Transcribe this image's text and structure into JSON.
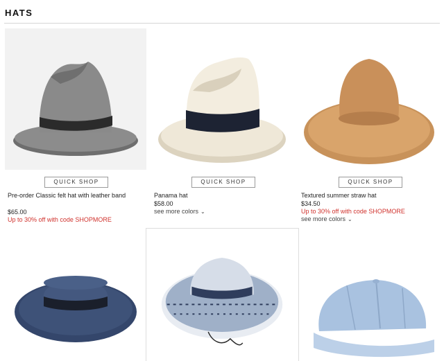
{
  "section": {
    "title": "HATS"
  },
  "products": [
    {
      "quick_shop": "QUICK SHOP",
      "name": "Pre-order Classic felt hat with leather band",
      "price": "$65.00",
      "promo": "Up to 30% off with code SHOPMORE"
    },
    {
      "quick_shop": "QUICK SHOP",
      "name": "Panama hat",
      "price": "$58.00",
      "more_colors": "see more colors"
    },
    {
      "quick_shop": "QUICK SHOP",
      "name": "Textured summer straw hat",
      "price": "$34.50",
      "promo": "Up to 30% off with code SHOPMORE",
      "more_colors": "see more colors"
    }
  ],
  "colors": {
    "promo": "#d0322d",
    "felt_hat": "#8a8a8a",
    "panama_hat": "#efe8d8",
    "straw_hat": "#d9a46b",
    "boater_hat": "#3e5278",
    "cap": "#a9c2e0"
  }
}
